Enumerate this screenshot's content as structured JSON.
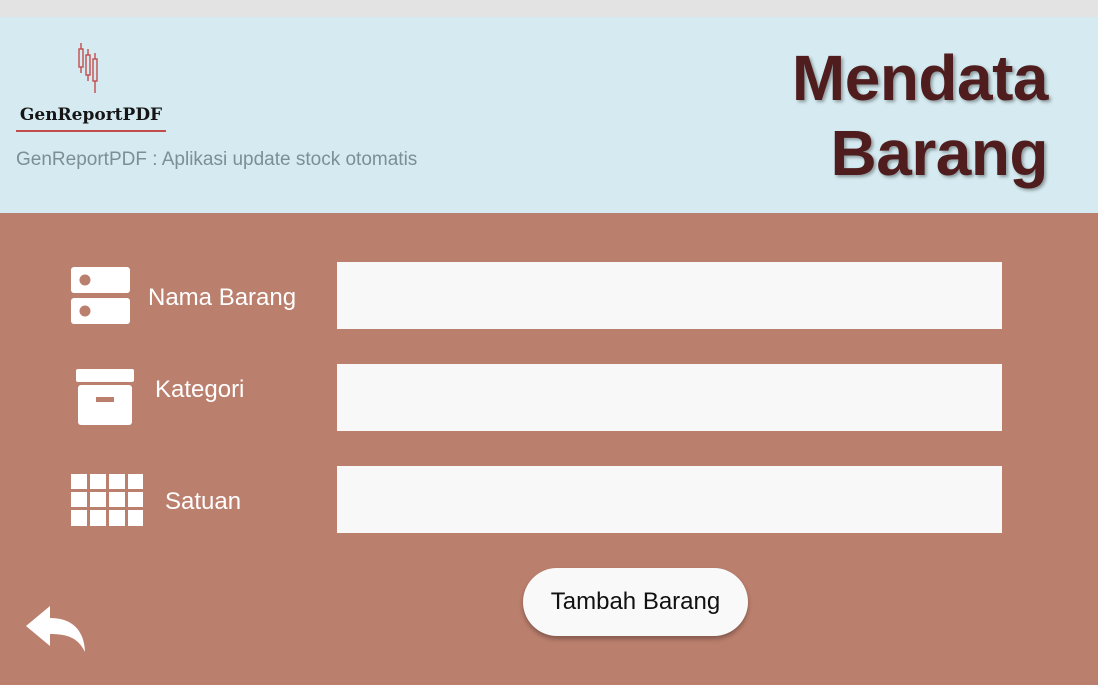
{
  "app": {
    "logo_text": "GenReportPDF",
    "subtitle": "GenReportPDF : Aplikasi update stock otomatis",
    "title_line1": "Mendata",
    "title_line2": "Barang"
  },
  "form": {
    "fields": [
      {
        "label": "Nama Barang",
        "icon": "server-icon",
        "value": ""
      },
      {
        "label": "Kategori",
        "icon": "archive-box-icon",
        "value": ""
      },
      {
        "label": "Satuan",
        "icon": "grid-icon",
        "value": ""
      }
    ],
    "submit_label": "Tambah Barang"
  },
  "nav": {
    "back_icon": "back-arrow-icon"
  },
  "colors": {
    "header_bg": "#d5ebf1",
    "body_bg": "#bb7f6d",
    "title": "#4f1d1d",
    "logo_accent": "#c24d4d"
  }
}
